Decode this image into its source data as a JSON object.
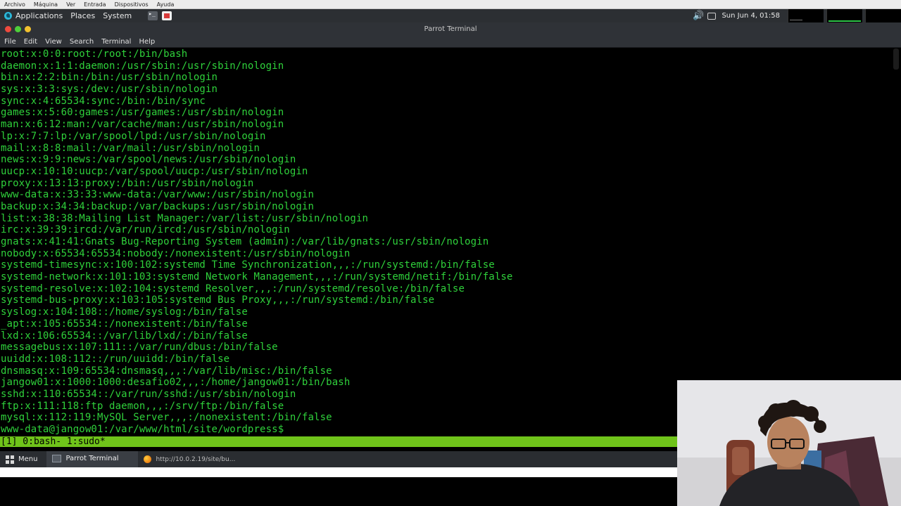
{
  "vm_menu": [
    "Archivo",
    "Máquina",
    "Ver",
    "Entrada",
    "Dispositivos",
    "Ayuda"
  ],
  "top_panel": {
    "applications": "Applications",
    "places": "Places",
    "system": "System",
    "clock": "Sun Jun 4, 01:58"
  },
  "window": {
    "title": "Parrot Terminal",
    "menu": [
      "File",
      "Edit",
      "View",
      "Search",
      "Terminal",
      "Help"
    ]
  },
  "terminal": {
    "lines": [
      "root:x:0:0:root:/root:/bin/bash",
      "daemon:x:1:1:daemon:/usr/sbin:/usr/sbin/nologin",
      "bin:x:2:2:bin:/bin:/usr/sbin/nologin",
      "sys:x:3:3:sys:/dev:/usr/sbin/nologin",
      "sync:x:4:65534:sync:/bin:/bin/sync",
      "games:x:5:60:games:/usr/games:/usr/sbin/nologin",
      "man:x:6:12:man:/var/cache/man:/usr/sbin/nologin",
      "lp:x:7:7:lp:/var/spool/lpd:/usr/sbin/nologin",
      "mail:x:8:8:mail:/var/mail:/usr/sbin/nologin",
      "news:x:9:9:news:/var/spool/news:/usr/sbin/nologin",
      "uucp:x:10:10:uucp:/var/spool/uucp:/usr/sbin/nologin",
      "proxy:x:13:13:proxy:/bin:/usr/sbin/nologin",
      "www-data:x:33:33:www-data:/var/www:/usr/sbin/nologin",
      "backup:x:34:34:backup:/var/backups:/usr/sbin/nologin",
      "list:x:38:38:Mailing List Manager:/var/list:/usr/sbin/nologin",
      "irc:x:39:39:ircd:/var/run/ircd:/usr/sbin/nologin",
      "gnats:x:41:41:Gnats Bug-Reporting System (admin):/var/lib/gnats:/usr/sbin/nologin",
      "nobody:x:65534:65534:nobody:/nonexistent:/usr/sbin/nologin",
      "systemd-timesync:x:100:102:systemd Time Synchronization,,,:/run/systemd:/bin/false",
      "systemd-network:x:101:103:systemd Network Management,,,:/run/systemd/netif:/bin/false",
      "systemd-resolve:x:102:104:systemd Resolver,,,:/run/systemd/resolve:/bin/false",
      "systemd-bus-proxy:x:103:105:systemd Bus Proxy,,,:/run/systemd:/bin/false",
      "syslog:x:104:108::/home/syslog:/bin/false",
      "_apt:x:105:65534::/nonexistent:/bin/false",
      "lxd:x:106:65534::/var/lib/lxd/:/bin/false",
      "messagebus:x:107:111::/var/run/dbus:/bin/false",
      "uuidd:x:108:112::/run/uuidd:/bin/false",
      "dnsmasq:x:109:65534:dnsmasq,,,:/var/lib/misc:/bin/false",
      "jangow01:x:1000:1000:desafio02,,,:/home/jangow01:/bin/bash",
      "sshd:x:110:65534::/var/run/sshd:/usr/sbin/nologin",
      "ftp:x:111:118:ftp daemon,,,:/srv/ftp:/bin/false",
      "mysql:x:112:119:MySQL Server,,,:/nonexistent:/bin/false",
      "www-data@jangow01:/var/www/html/site/wordpress$"
    ],
    "status_line": "[1] 0:bash- 1:sudo*"
  },
  "taskbar": {
    "menu_label": "Menu",
    "tasks": [
      "Parrot Terminal",
      "http://10.0.2.19/site/bu..."
    ]
  }
}
